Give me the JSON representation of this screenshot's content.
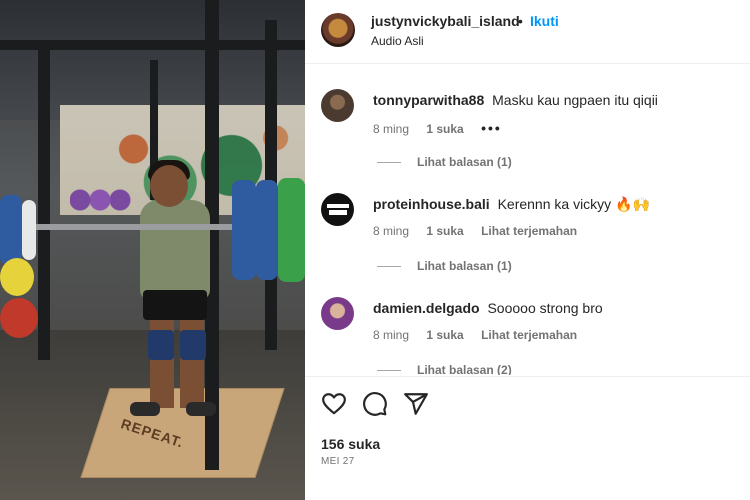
{
  "post": {
    "username": "justynvickybali_island",
    "separator": "•",
    "follow_label": "Ikuti",
    "audio": "Audio Asli",
    "media_floor_text": "REPEAT."
  },
  "comments": [
    {
      "username": "tonnyparwitha88",
      "text": "Masku kau ngpaen itu qiqii",
      "time": "8 ming",
      "likes": "1 suka",
      "extra": "•••",
      "replies": "Lihat balasan (1)"
    },
    {
      "username": "proteinhouse.bali",
      "text": "Kerennn ka vickyy 🔥🙌",
      "time": "8 ming",
      "likes": "1 suka",
      "extra": "Lihat terjemahan",
      "replies": "Lihat balasan (1)"
    },
    {
      "username": "damien.delgado",
      "text": "Sooooo strong bro",
      "time": "8 ming",
      "likes": "1 suka",
      "extra": "Lihat terjemahan",
      "replies": "Lihat balasan (2)"
    }
  ],
  "footer": {
    "likes": "156 suka",
    "date": "MEI 27"
  },
  "icons": {
    "like": "heart-icon",
    "comment": "comment-icon",
    "share": "share-icon"
  },
  "colors": {
    "link_blue": "#0095f6",
    "text": "#262626",
    "muted": "#737373"
  }
}
